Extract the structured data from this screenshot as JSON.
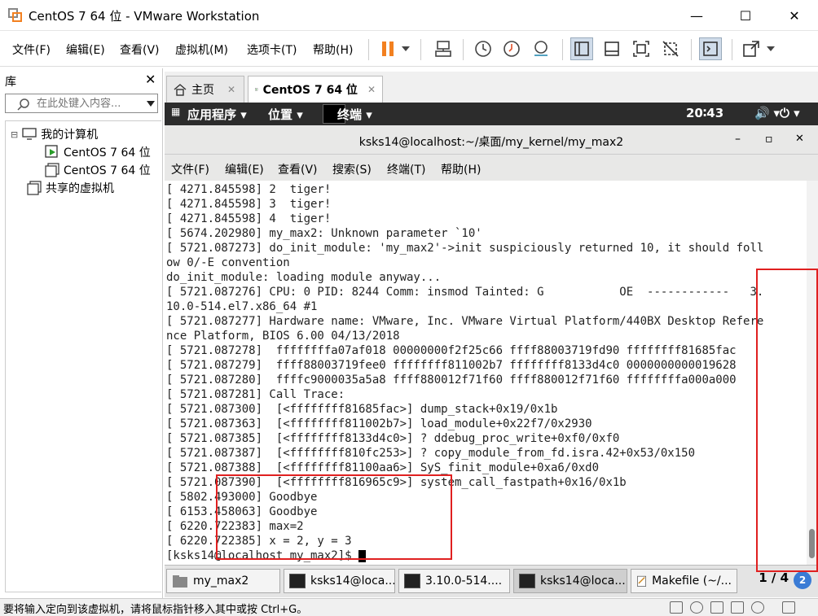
{
  "window": {
    "title": "CentOS 7 64 位 - VMware Workstation",
    "controls": {
      "minimize": "—",
      "maximize": "☐",
      "close": "✕"
    }
  },
  "menu": {
    "items": [
      "文件(F)",
      "编辑(E)",
      "查看(V)",
      "虚拟机(M)",
      "选项卡(T)",
      "帮助(H)"
    ]
  },
  "toolbar": {
    "icons": [
      "pause-icon",
      "dropdown-icon",
      "send-keys-icon",
      "snapshot-icon",
      "revert-snapshot-icon",
      "snapshot-manager-icon",
      "library-view-icon",
      "thumbnail-view-icon",
      "fullscreen-icon",
      "unity-icon",
      "console-icon",
      "stretch-icon",
      "dropdown-icon"
    ],
    "accent": "#f28020"
  },
  "library": {
    "title": "库",
    "close": "✕",
    "search_placeholder": "在此处键入内容...",
    "tree": [
      {
        "label": "我的计算机",
        "expander": "⊟"
      },
      {
        "label": "CentOS 7 64 位",
        "running": true
      },
      {
        "label": "CentOS 7 64 位",
        "running": false
      },
      {
        "label": "共享的虚拟机"
      }
    ]
  },
  "tabs": [
    {
      "label": "主页",
      "close": "✕",
      "active": false
    },
    {
      "label": "CentOS 7 64 位",
      "close": "✕",
      "active": true
    }
  ],
  "guest": {
    "topbar": {
      "apps": "应用程序 ▾",
      "places": "位置 ▾",
      "terminal": "终端 ▾",
      "clock": "20∶43",
      "volume": "🔊 ▾",
      "power": "⏻ ▾"
    },
    "terminal": {
      "title": "ksks14@localhost:~/桌面/my_kernel/my_max2",
      "controls": {
        "minimize": "–",
        "maximize": "▫",
        "close": "✕"
      },
      "menu": [
        "文件(F)",
        "编辑(E)",
        "查看(V)",
        "搜索(S)",
        "终端(T)",
        "帮助(H)"
      ],
      "lines": [
        "[ 4271.845598] 2  tiger!",
        "[ 4271.845598] 3  tiger!",
        "[ 4271.845598] 4  tiger!",
        "[ 5674.202980] my_max2: Unknown parameter `10'",
        "[ 5721.087273] do_init_module: 'my_max2'->init suspiciously returned 10, it should foll",
        "ow 0/-E convention",
        "do_init_module: loading module anyway...",
        "[ 5721.087276] CPU: 0 PID: 8244 Comm: insmod Tainted: G           OE  ------------   3.",
        "10.0-514.el7.x86_64 #1",
        "[ 5721.087277] Hardware name: VMware, Inc. VMware Virtual Platform/440BX Desktop Refere",
        "nce Platform, BIOS 6.00 04/13/2018",
        "[ 5721.087278]  ffffffffa07af018 00000000f2f25c66 ffff88003719fd90 ffffffff81685fac",
        "[ 5721.087279]  ffff88003719fee0 ffffffff811002b7 ffffffff8133d4c0 0000000000019628",
        "[ 5721.087280]  ffffc9000035a5a8 ffff880012f71f60 ffff880012f71f60 ffffffffa000a000",
        "[ 5721.087281] Call Trace:",
        "[ 5721.087300]  [<ffffffff81685fac>] dump_stack+0x19/0x1b",
        "[ 5721.087363]  [<ffffffff811002b7>] load_module+0x22f7/0x2930",
        "[ 5721.087385]  [<ffffffff8133d4c0>] ? ddebug_proc_write+0xf0/0xf0",
        "[ 5721.087387]  [<ffffffff810fc253>] ? copy_module_from_fd.isra.42+0x53/0x150",
        "[ 5721.087388]  [<ffffffff81100aa6>] SyS_finit_module+0xa6/0xd0",
        "[ 5721.087390]  [<ffffffff816965c9>] system_call_fastpath+0x16/0x1b",
        "[ 5802.493000] Goodbye",
        "[ 6153.458063] Goodbye",
        "[ 6220.722383] max=2",
        "[ 6220.722385] x = 2, y = 3"
      ],
      "prompt": "[ksks14@localhost my_max2]$ "
    },
    "taskbar": {
      "items": [
        {
          "label": "my_max2",
          "active": false
        },
        {
          "label": "ksks14@loca...",
          "active": false
        },
        {
          "label": "3.10.0-514....",
          "active": false
        },
        {
          "label": "ksks14@loca...",
          "active": true
        },
        {
          "label": "Makefile (~/...",
          "active": false
        }
      ],
      "pager": "1 / 4",
      "badge": "2"
    }
  },
  "statusbar": {
    "message": "要将输入定向到该虚拟机，请将鼠标指针移入其中或按 Ctrl+G。",
    "icons": [
      "hdd-icon",
      "cdrom-icon",
      "network-icon",
      "sound-icon",
      "usb-icon",
      "fullscreen-icon"
    ]
  },
  "annotation_color": "#e02020"
}
